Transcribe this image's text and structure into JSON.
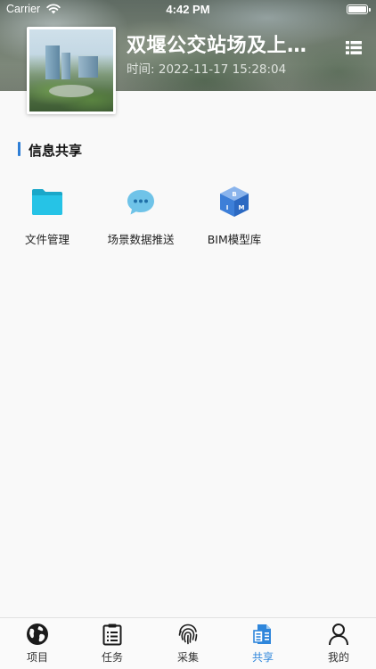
{
  "status_bar": {
    "carrier": "Carrier",
    "time": "4:42 PM"
  },
  "project": {
    "title": "双堰公交站场及上…",
    "time_label": "时间:",
    "time_value": "2022-11-17 15:28:04"
  },
  "section": {
    "title": "信息共享",
    "accent_color": "#2f7fd6"
  },
  "share_items": [
    {
      "label": "文件管理",
      "icon": "folder-icon"
    },
    {
      "label": "场景数据推送",
      "icon": "chat-bubble-icon"
    },
    {
      "label": "BIM模型库",
      "icon": "bim-cube-icon"
    }
  ],
  "tabbar": {
    "active_color": "#2f86db",
    "tabs": [
      {
        "label": "项目",
        "icon": "globe-icon"
      },
      {
        "label": "任务",
        "icon": "clipboard-icon"
      },
      {
        "label": "采集",
        "icon": "fingerprint-icon"
      },
      {
        "label": "共享",
        "icon": "share-document-icon",
        "active": true
      },
      {
        "label": "我的",
        "icon": "user-icon"
      }
    ]
  }
}
